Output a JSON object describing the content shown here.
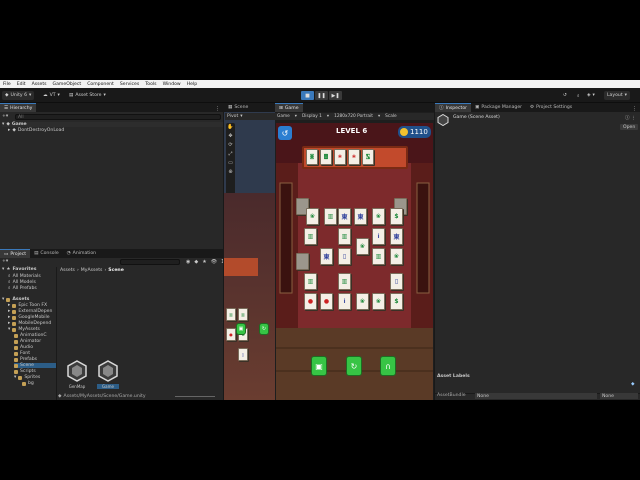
{
  "menubar": [
    "File",
    "Edit",
    "Assets",
    "GameObject",
    "Component",
    "Services",
    "Tools",
    "Window",
    "Help"
  ],
  "toolbar": {
    "account": "Unity 6",
    "vt": "VT",
    "asset_store": "Asset Store",
    "layout": "Layout"
  },
  "hierarchy": {
    "tab": "Hierarchy",
    "search_placeholder": "All",
    "scene": "Game",
    "child": "DontDestroyOnLoad"
  },
  "scene_tab": {
    "label": "Scene",
    "pivot": "Pivot"
  },
  "game_tab": {
    "label": "Game",
    "display_mode": "Game",
    "display": "Display 1",
    "resolution": "1280x720 Portrait",
    "scale": "Scale"
  },
  "game": {
    "level": "LEVEL 6",
    "coins": "1110",
    "dock_tiles": [
      "🀙",
      "🀡",
      "❀",
      "❀",
      "🀛"
    ]
  },
  "inspector": {
    "tab": "Inspector",
    "tab2": "Package Manager",
    "tab3": "Project Settings",
    "title": "Game (Scene Asset)",
    "open": "Open",
    "asset_labels": "Asset Labels",
    "assetbundle_label": "AssetBundle",
    "bundle_value": "None",
    "variant_value": "None"
  },
  "project": {
    "tabs": [
      "Project",
      "Console",
      "Animation"
    ],
    "count": "12",
    "favorites": "Favorites",
    "fav_items": [
      "All Materials",
      "All Models",
      "All Prefabs"
    ],
    "assets": "Assets",
    "tree": [
      "Epic Toon FX",
      "ExternalDepen",
      "GoogleMobile",
      "MobileDepend",
      "MyAssets",
      "AnimationC",
      "Animator",
      "Audio",
      "Font",
      "Prefabs",
      "Scene",
      "Scripts",
      "Sprites",
      "bg"
    ],
    "breadcrumb": [
      "Assets",
      "MyAssets",
      "Scene"
    ],
    "files": [
      "GenMap",
      "Game"
    ],
    "path": "Assets/MyAssets/Scene/Game.unity"
  },
  "colors": {
    "accent": "#3a79bb",
    "panel": "#282828",
    "coin": "#f2c12e",
    "tile_green": "#1e8a3c"
  }
}
